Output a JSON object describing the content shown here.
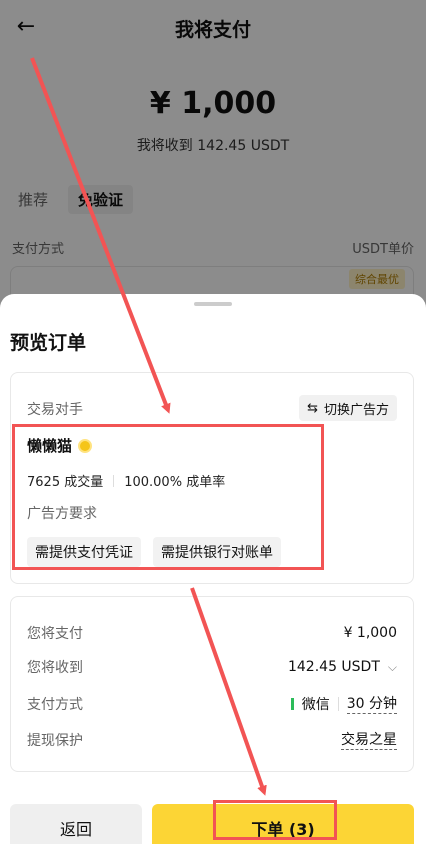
{
  "header": {
    "title": "我将支付"
  },
  "summary": {
    "amount": "¥ 1,000",
    "receive": "我将收到 142.45 USDT"
  },
  "tabs": [
    {
      "label": "推荐"
    },
    {
      "label": "免验证"
    }
  ],
  "columns": {
    "left": "支付方式",
    "right": "USDT单价"
  },
  "pay_card": {
    "badge": "综合最优"
  },
  "sheet": {
    "title": "预览订单",
    "counterparty_label": "交易对手",
    "switch_label": "切换广告方",
    "merchant_name": "懒懒猫",
    "volume": "7625 成交量",
    "completion": "100.00% 成单率",
    "requirements_label": "广告方要求",
    "requirements": [
      "需提供支付凭证",
      "需提供银行对账单"
    ]
  },
  "details": {
    "pay": {
      "label": "您将支付",
      "value": "¥ 1,000"
    },
    "receive": {
      "label": "您将收到",
      "value": "142.45 USDT"
    },
    "method": {
      "label": "支付方式",
      "value": "微信",
      "time": "30 分钟"
    },
    "protection": {
      "label": "提现保护",
      "value": "交易之星"
    }
  },
  "actions": {
    "back": "返回",
    "order": "下单 (3)"
  },
  "colors": {
    "accent": "#fcd535",
    "annotation": "#f25454",
    "wechat": "#2cbc5a"
  }
}
